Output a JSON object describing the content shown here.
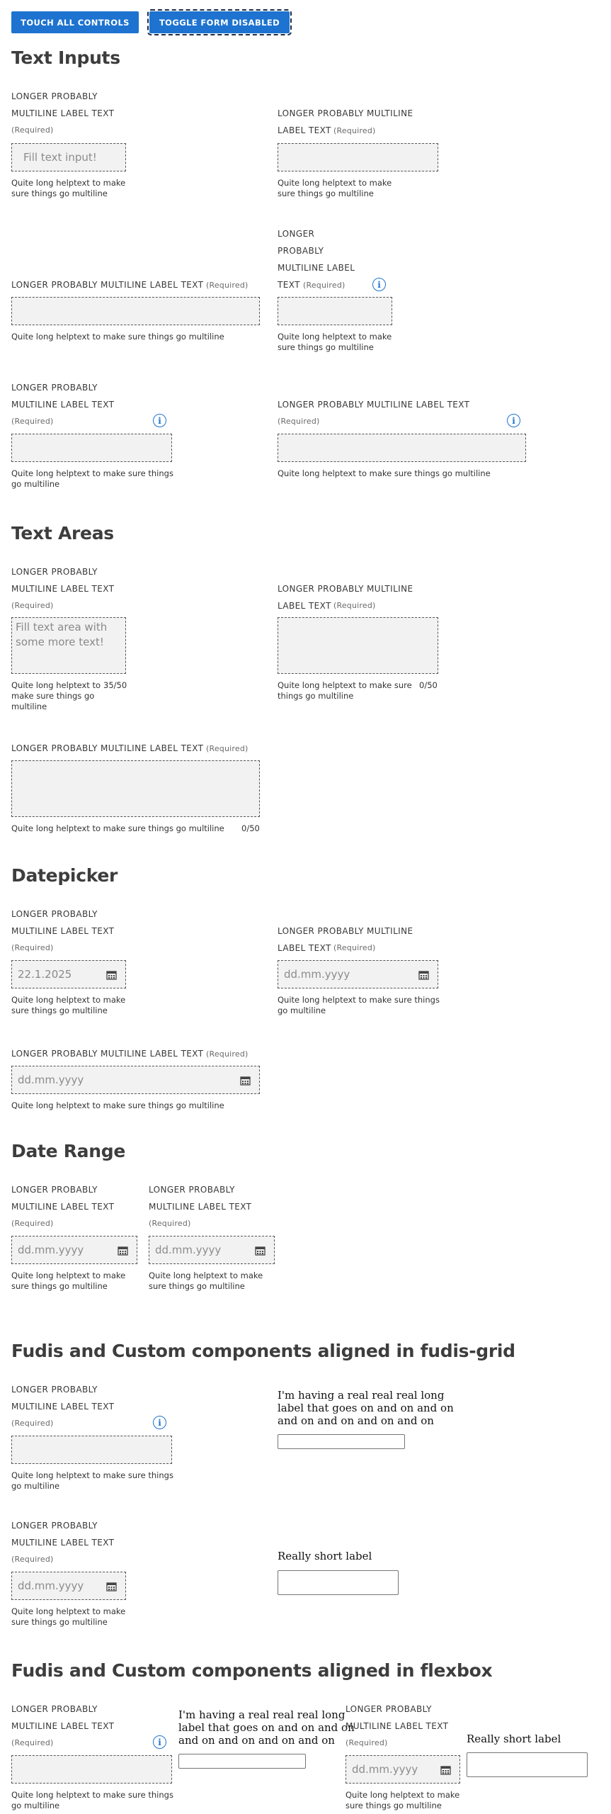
{
  "toolbar": {
    "touch_all_label": "TOUCH ALL CONTROLS",
    "toggle_disabled_label": "TOGGLE FORM DISABLED"
  },
  "sections": {
    "text_inputs": "Text Inputs",
    "text_areas": "Text Areas",
    "datepicker": "Datepicker",
    "date_range": "Date Range",
    "grid": "Fudis and Custom components aligned in fudis-grid",
    "flexbox": "Fudis and Custom components aligned in flexbox"
  },
  "common": {
    "label_line_1": "LONGER PROBABLY",
    "label_line_2": "MULTILINE LABEL TEXT",
    "label_multiline_a": "LONGER PROBABLY MULTILINE",
    "label_text": "LABEL TEXT",
    "label_full": "LONGER PROBABLY MULTILINE LABEL TEXT",
    "label_w1": "LONGER",
    "label_w2": "PROBABLY",
    "label_w3": "MULTILINE LABEL",
    "label_w4": "TEXT",
    "required": "(Required)",
    "help_full": "Quite long helptext to make sure things go multiline",
    "help_a1": "Quite long helptext to make",
    "help_a2": "sure things go multiline",
    "help_b1": "Quite long helptext to make sure things",
    "help_b2": "go multiline",
    "help_c1": "Quite long helptext to",
    "help_c2": "make sure things go",
    "help_c3": "multiline",
    "help_d1": "Quite long helptext to make sure",
    "help_d2": "things go multiline",
    "date_placeholder": "dd.mm.yyyy",
    "info_glyph": "i"
  },
  "text_inputs": {
    "first_placeholder": "Fill text input!"
  },
  "text_areas": {
    "first_value_line_1": "Fill text area with",
    "first_value_line_2": "some more text!",
    "counter_1": "35/50",
    "counter_2": "0/50",
    "counter_3": "0/50"
  },
  "datepicker": {
    "first_value": "22.1.2025"
  },
  "custom": {
    "long_label_grid_1": "I'm having a real real real long",
    "long_label_grid_2": "label that goes on and on and on",
    "long_label_grid_3": "and on and on and on and on",
    "short_label": "Really short label",
    "long_label_flex_1": "I'm having a real real real long",
    "long_label_flex_2": "label that goes on and on and on",
    "long_label_flex_3": "and on and on and on and on"
  },
  "icons": {
    "info": "info-icon",
    "calendar": "calendar-icon"
  },
  "colors": {
    "primary": "#1d73cf",
    "heading": "#3d3d3d",
    "input_bg": "#f2f2f2"
  }
}
